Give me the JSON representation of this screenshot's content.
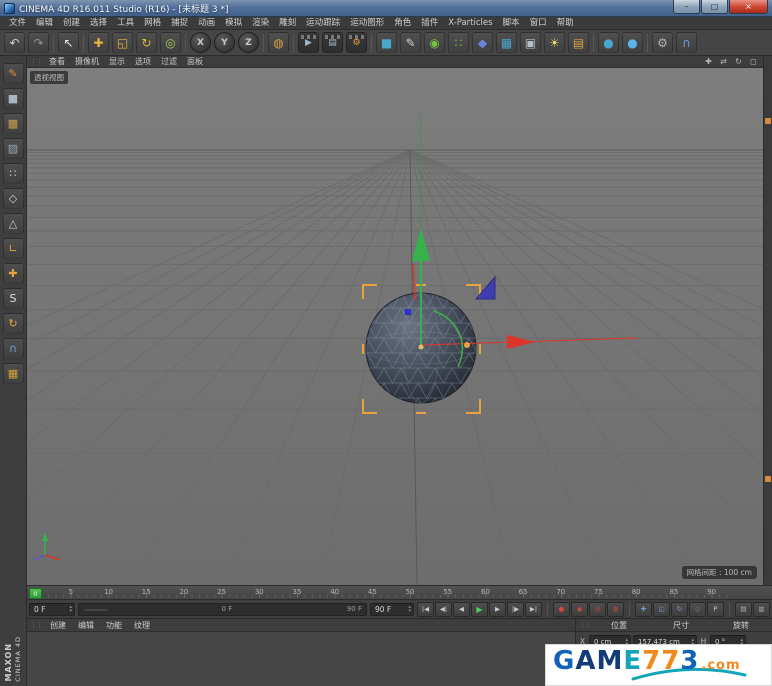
{
  "window": {
    "title": "CINEMA 4D R16.011 Studio (R16) - [未标题 3 *]",
    "minimize_glyph": "–",
    "maximize_glyph": "□",
    "close_glyph": "×"
  },
  "menubar": {
    "items": [
      "文件",
      "编辑",
      "创建",
      "选择",
      "工具",
      "网格",
      "捕捉",
      "动画",
      "模拟",
      "渲染",
      "雕刻",
      "运动跟踪",
      "运动图形",
      "角色",
      "插件",
      "X-Particles",
      "脚本",
      "窗口",
      "帮助"
    ]
  },
  "toolbar": {
    "groups": [
      [
        {
          "name": "undo-button",
          "glyph": "↶",
          "color": "#cfcfcf"
        },
        {
          "name": "redo-button",
          "glyph": "↷",
          "color": "#8f8f8f"
        }
      ],
      [
        {
          "name": "live-selection-tool",
          "glyph": "↖",
          "color": "#eaeaea"
        }
      ],
      [
        {
          "name": "move-tool",
          "glyph": "✚",
          "color": "#e8b23e"
        },
        {
          "name": "scale-tool",
          "glyph": "◱",
          "color": "#e8b23e"
        },
        {
          "name": "rotate-tool",
          "glyph": "↻",
          "color": "#e8b23e"
        },
        {
          "name": "last-used-tool",
          "glyph": "◎",
          "color": "#a8c858"
        }
      ],
      [
        {
          "name": "lock-x-axis-button",
          "glyph": "X",
          "cls": "axisbtn"
        },
        {
          "name": "lock-y-axis-button",
          "glyph": "Y",
          "cls": "axisbtn"
        },
        {
          "name": "lock-z-axis-button",
          "glyph": "Z",
          "cls": "axisbtn"
        }
      ],
      [
        {
          "name": "coordinate-system-button",
          "glyph": "◍",
          "color": "#d8a23c"
        }
      ],
      [
        {
          "name": "render-view-button",
          "glyph": "▶",
          "color": "#9fb8c8",
          "cls": "clapper"
        },
        {
          "name": "render-picture-viewer-button",
          "glyph": "▤",
          "color": "#9fb8c8",
          "cls": "clapper"
        },
        {
          "name": "render-settings-button",
          "glyph": "⚙",
          "color": "#e8a23c",
          "cls": "clapper"
        }
      ],
      [
        {
          "name": "add-cube-button",
          "glyph": "■",
          "color": "#49a7c9"
        },
        {
          "name": "add-spline-button",
          "glyph": "✎",
          "color": "#c8d0da"
        },
        {
          "name": "add-subdivision-surface-button",
          "glyph": "◉",
          "color": "#7ac043"
        },
        {
          "name": "add-array-button",
          "glyph": "∷",
          "color": "#7ac043"
        },
        {
          "name": "add-deformer-button",
          "glyph": "◆",
          "color": "#6a86d8"
        },
        {
          "name": "add-floor-button",
          "glyph": "▦",
          "color": "#49a7c9"
        },
        {
          "name": "add-camera-button",
          "glyph": "▣",
          "color": "#b8bec6"
        },
        {
          "name": "add-light-button",
          "glyph": "☀",
          "color": "#ead76a"
        },
        {
          "name": "add-environment-button",
          "glyph": "▤",
          "color": "#d8a23c"
        }
      ],
      [
        {
          "name": "add-sky-button",
          "glyph": "●",
          "color": "#49a7c9"
        },
        {
          "name": "add-physical-sky-button",
          "glyph": "●",
          "color": "#5ab4e8"
        }
      ],
      [
        {
          "name": "modeling-settings-button",
          "glyph": "⚙",
          "color": "#b0b0b0"
        },
        {
          "name": "snap-magnet-button",
          "glyph": "∩",
          "color": "#6aa0d8"
        }
      ]
    ]
  },
  "left_toolbar": {
    "icons": [
      {
        "name": "make-editable-button",
        "glyph": "✎",
        "color": "#d98a3a"
      },
      {
        "name": "model-mode-button",
        "glyph": "■",
        "color": "#a8b6c4"
      },
      {
        "name": "texture-mode-button",
        "glyph": "▩",
        "color": "#c9a04c"
      },
      {
        "name": "workplane-mode-button",
        "glyph": "▨",
        "color": "#9aa7b4"
      },
      {
        "name": "points-mode-button",
        "glyph": "∷",
        "color": "#d0d0d0"
      },
      {
        "name": "edges-mode-button",
        "glyph": "◇",
        "color": "#d0d0d0"
      },
      {
        "name": "polygons-mode-button",
        "glyph": "△",
        "color": "#d0d0d0"
      },
      {
        "name": "axis-mode-button",
        "glyph": "∟",
        "color": "#e8a23c"
      },
      {
        "name": "object-axis-button",
        "glyph": "✚",
        "color": "#e8a23c"
      },
      {
        "name": "snap-toggle-button",
        "glyph": "S",
        "color": "#e0e0e0"
      },
      {
        "name": "quantize-toggle-button",
        "glyph": "↻",
        "color": "#e8a23c"
      },
      {
        "name": "magnet-snap-button",
        "glyph": "∩",
        "color": "#6aa0d8"
      },
      {
        "name": "workplane-snap-button",
        "glyph": "▦",
        "color": "#d8a23c"
      }
    ]
  },
  "viewport": {
    "menu_items": [
      "查看",
      "摄像机",
      "显示",
      "选项",
      "过滤",
      "面板"
    ],
    "nav_icons": [
      {
        "name": "pan-view-icon",
        "glyph": "✚"
      },
      {
        "name": "zoom-view-icon",
        "glyph": "⇄"
      },
      {
        "name": "rotate-view-icon",
        "glyph": "↻"
      },
      {
        "name": "toggle-view-icon",
        "glyph": "◻"
      }
    ],
    "label": "透视视图",
    "grid_info": "网格间距 : 100 cm"
  },
  "ruler": {
    "marker": "0",
    "ticks": [
      "5",
      "10",
      "15",
      "20",
      "25",
      "30",
      "35",
      "40",
      "45",
      "50",
      "55",
      "60",
      "65",
      "70",
      "75",
      "80",
      "85",
      "90"
    ]
  },
  "transport": {
    "current_frame": "0 F",
    "slider_start": "0 F",
    "slider_end": "90 F",
    "end_frame": "90 F",
    "buttons": [
      {
        "name": "goto-start-button",
        "label": "|◀"
      },
      {
        "name": "prev-key-button",
        "label": "◀|"
      },
      {
        "name": "prev-frame-button",
        "label": "◀"
      },
      {
        "name": "play-button",
        "label": "▶",
        "cls": "play"
      },
      {
        "name": "next-frame-button",
        "label": "▶"
      },
      {
        "name": "next-key-button",
        "label": "|▶"
      },
      {
        "name": "goto-end-button",
        "label": "▶|"
      }
    ],
    "record_buttons": [
      {
        "name": "record-keyframe-button",
        "glyph": "●",
        "color": "#d34b3a"
      },
      {
        "name": "autokey-button",
        "glyph": "◉",
        "color": "#d34b3a"
      },
      {
        "name": "record-selection-button",
        "glyph": "◎",
        "color": "#d34b3a"
      },
      {
        "name": "keyframe-presets-button",
        "glyph": "◍",
        "color": "#d34b3a"
      }
    ],
    "toggles": [
      {
        "name": "position-keys-toggle",
        "glyph": "✚",
        "color": "#7a9fd0"
      },
      {
        "name": "scale-keys-toggle",
        "glyph": "◱",
        "color": "#7a9fd0"
      },
      {
        "name": "rotation-keys-toggle",
        "glyph": "↻",
        "color": "#7a9fd0"
      },
      {
        "name": "parameter-keys-toggle",
        "glyph": "◇",
        "color": "#7a9fd0"
      },
      {
        "name": "pla-keys-toggle",
        "glyph": "P",
        "color": "#c8c8c8"
      }
    ],
    "panel_buttons": [
      {
        "name": "timeline-panel-button",
        "glyph": "▤",
        "color": "#b0b0b0"
      },
      {
        "name": "fcurve-panel-button",
        "glyph": "▥",
        "color": "#b0b0b0"
      }
    ]
  },
  "material_manager": {
    "menu_items": [
      "创建",
      "编辑",
      "功能",
      "纹理"
    ]
  },
  "coordinates": {
    "headers": [
      "位置",
      "尺寸",
      "旋转"
    ],
    "row1": {
      "pos_axis": "X",
      "pos_value": "0 cm",
      "size_value": "157.473 cm",
      "rot_axis": "H",
      "rot_value": "0 °"
    }
  },
  "branding": {
    "maxon": "MAXON",
    "product": "CINEMA 4D"
  },
  "watermark": {
    "parts": [
      {
        "name": "watermark-letter",
        "glyph": "G",
        "color": "#1462b8"
      },
      {
        "name": "watermark-letter",
        "glyph": "A",
        "color": "#123c78"
      },
      {
        "name": "watermark-letter",
        "glyph": "M",
        "color": "#123c78"
      },
      {
        "name": "watermark-letter",
        "glyph": "E",
        "color": "#14a5b8"
      },
      {
        "name": "watermark-letter",
        "glyph": "7",
        "color": "#f08a1d"
      },
      {
        "name": "watermark-letter",
        "glyph": "7",
        "color": "#f08a1d"
      },
      {
        "name": "watermark-letter",
        "glyph": "3",
        "color": "#1462b8"
      },
      {
        "name": "watermark-suffix",
        "glyph": ".com",
        "color": "#f08a1d",
        "cls": "small"
      }
    ]
  },
  "ui": {
    "grip": "⋮⋮",
    "spinner_up": "▴",
    "spinner_down": "▾"
  },
  "colors": {
    "accent_orange": "#e8a23c",
    "axis_x": "#dd3528",
    "axis_y": "#35b24a",
    "axis_z": "#3535d0",
    "selection_orange": "#e8a23c",
    "viewport_bg": "#777777",
    "panel_bg": "#3f3f3f",
    "titlebar_blue": "#53719b"
  }
}
